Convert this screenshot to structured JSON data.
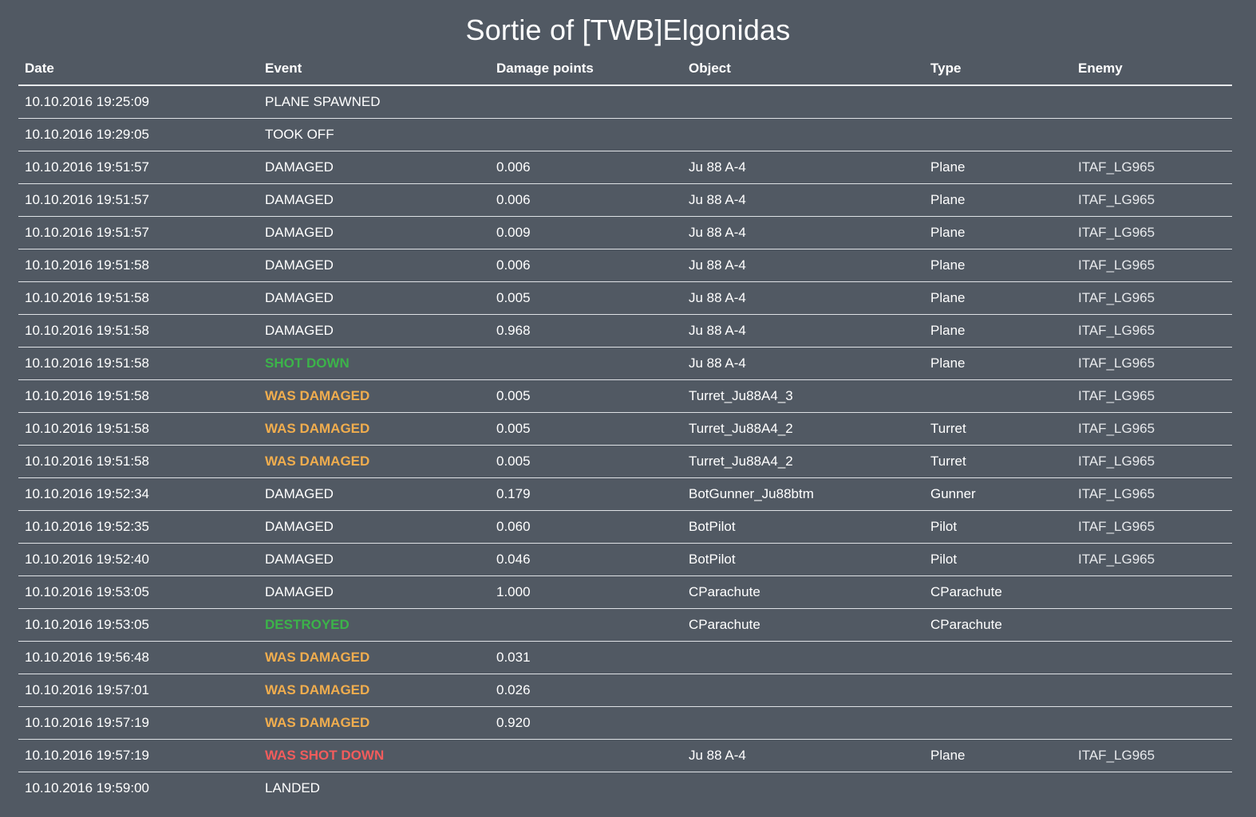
{
  "page": {
    "title": "Sortie of [TWB]Elgonidas"
  },
  "colors": {
    "background": "#515963",
    "text": "#ffffff",
    "success": "#3cb34a",
    "warning": "#f0ad4e",
    "danger": "#f25c5c"
  },
  "table": {
    "headers": {
      "date": "Date",
      "event": "Event",
      "damage": "Damage points",
      "object": "Object",
      "type": "Type",
      "enemy": "Enemy"
    },
    "rows": [
      {
        "date": "10.10.2016 19:25:09",
        "event": "PLANE SPAWNED",
        "status": "normal",
        "damage": "",
        "object": "",
        "type": "",
        "enemy": ""
      },
      {
        "date": "10.10.2016 19:29:05",
        "event": "TOOK OFF",
        "status": "normal",
        "damage": "",
        "object": "",
        "type": "",
        "enemy": ""
      },
      {
        "date": "10.10.2016 19:51:57",
        "event": "DAMAGED",
        "status": "normal",
        "damage": "0.006",
        "object": "Ju 88 A-4",
        "type": "Plane",
        "enemy": "ITAF_LG965"
      },
      {
        "date": "10.10.2016 19:51:57",
        "event": "DAMAGED",
        "status": "normal",
        "damage": "0.006",
        "object": "Ju 88 A-4",
        "type": "Plane",
        "enemy": "ITAF_LG965"
      },
      {
        "date": "10.10.2016 19:51:57",
        "event": "DAMAGED",
        "status": "normal",
        "damage": "0.009",
        "object": "Ju 88 A-4",
        "type": "Plane",
        "enemy": "ITAF_LG965"
      },
      {
        "date": "10.10.2016 19:51:58",
        "event": "DAMAGED",
        "status": "normal",
        "damage": "0.006",
        "object": "Ju 88 A-4",
        "type": "Plane",
        "enemy": "ITAF_LG965"
      },
      {
        "date": "10.10.2016 19:51:58",
        "event": "DAMAGED",
        "status": "normal",
        "damage": "0.005",
        "object": "Ju 88 A-4",
        "type": "Plane",
        "enemy": "ITAF_LG965"
      },
      {
        "date": "10.10.2016 19:51:58",
        "event": "DAMAGED",
        "status": "normal",
        "damage": "0.968",
        "object": "Ju 88 A-4",
        "type": "Plane",
        "enemy": "ITAF_LG965"
      },
      {
        "date": "10.10.2016 19:51:58",
        "event": "SHOT DOWN",
        "status": "shotdown",
        "damage": "",
        "object": "Ju 88 A-4",
        "type": "Plane",
        "enemy": "ITAF_LG965"
      },
      {
        "date": "10.10.2016 19:51:58",
        "event": "WAS DAMAGED",
        "status": "wasdamaged",
        "damage": "0.005",
        "object": "Turret_Ju88A4_3",
        "type": "",
        "enemy": "ITAF_LG965"
      },
      {
        "date": "10.10.2016 19:51:58",
        "event": "WAS DAMAGED",
        "status": "wasdamaged",
        "damage": "0.005",
        "object": "Turret_Ju88A4_2",
        "type": "Turret",
        "enemy": "ITAF_LG965"
      },
      {
        "date": "10.10.2016 19:51:58",
        "event": "WAS DAMAGED",
        "status": "wasdamaged",
        "damage": "0.005",
        "object": "Turret_Ju88A4_2",
        "type": "Turret",
        "enemy": "ITAF_LG965"
      },
      {
        "date": "10.10.2016 19:52:34",
        "event": "DAMAGED",
        "status": "normal",
        "damage": "0.179",
        "object": "BotGunner_Ju88btm",
        "type": "Gunner",
        "enemy": "ITAF_LG965"
      },
      {
        "date": "10.10.2016 19:52:35",
        "event": "DAMAGED",
        "status": "normal",
        "damage": "0.060",
        "object": "BotPilot",
        "type": "Pilot",
        "enemy": "ITAF_LG965"
      },
      {
        "date": "10.10.2016 19:52:40",
        "event": "DAMAGED",
        "status": "normal",
        "damage": "0.046",
        "object": "BotPilot",
        "type": "Pilot",
        "enemy": "ITAF_LG965"
      },
      {
        "date": "10.10.2016 19:53:05",
        "event": "DAMAGED",
        "status": "normal",
        "damage": "1.000",
        "object": "CParachute",
        "type": "CParachute",
        "enemy": ""
      },
      {
        "date": "10.10.2016 19:53:05",
        "event": "DESTROYED",
        "status": "destroyed",
        "damage": "",
        "object": "CParachute",
        "type": "CParachute",
        "enemy": ""
      },
      {
        "date": "10.10.2016 19:56:48",
        "event": "WAS DAMAGED",
        "status": "wasdamaged",
        "damage": "0.031",
        "object": "",
        "type": "",
        "enemy": ""
      },
      {
        "date": "10.10.2016 19:57:01",
        "event": "WAS DAMAGED",
        "status": "wasdamaged",
        "damage": "0.026",
        "object": "",
        "type": "",
        "enemy": ""
      },
      {
        "date": "10.10.2016 19:57:19",
        "event": "WAS DAMAGED",
        "status": "wasdamaged",
        "damage": "0.920",
        "object": "",
        "type": "",
        "enemy": ""
      },
      {
        "date": "10.10.2016 19:57:19",
        "event": "WAS SHOT DOWN",
        "status": "wasshotdown",
        "damage": "",
        "object": "Ju 88 A-4",
        "type": "Plane",
        "enemy": "ITAF_LG965"
      },
      {
        "date": "10.10.2016 19:59:00",
        "event": "LANDED",
        "status": "normal",
        "damage": "",
        "object": "",
        "type": "",
        "enemy": ""
      }
    ]
  }
}
